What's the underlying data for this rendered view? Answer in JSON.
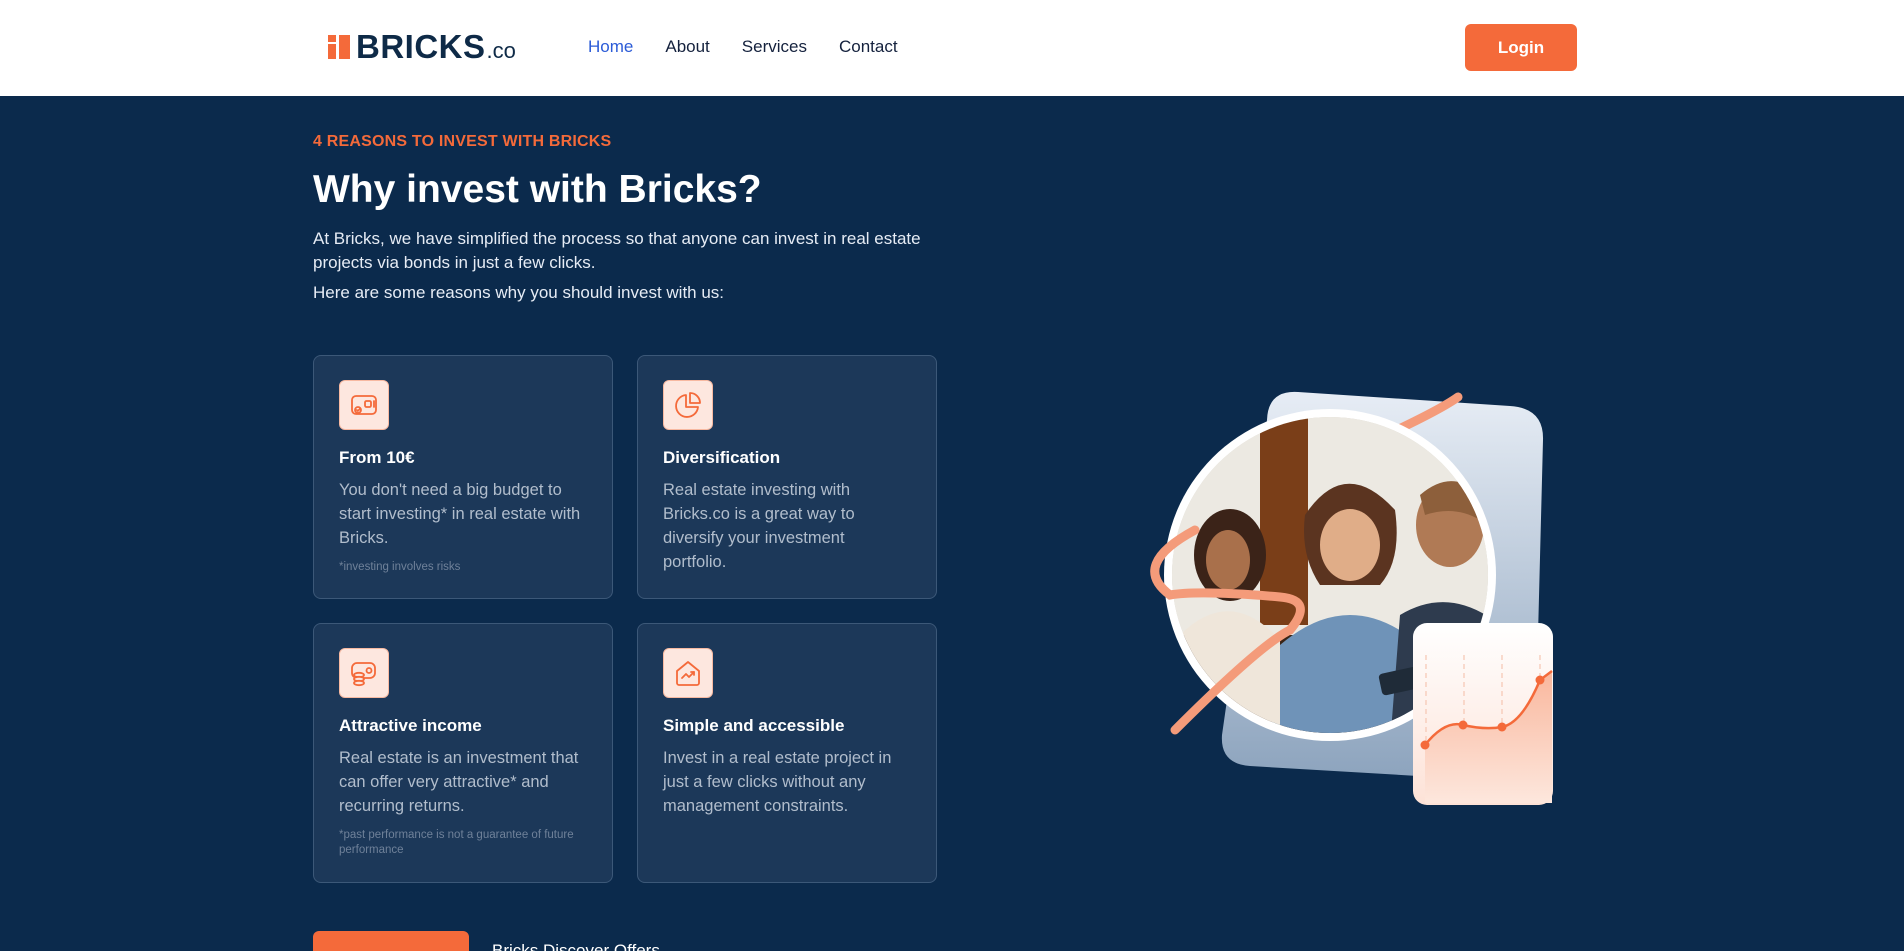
{
  "header": {
    "logo_name": "BRICKS",
    "logo_suffix": ".co",
    "nav": [
      {
        "label": "Home"
      },
      {
        "label": "About"
      },
      {
        "label": "Services"
      },
      {
        "label": "Contact"
      }
    ],
    "login_label": "Login"
  },
  "section": {
    "eyebrow": "4 REASONS TO INVEST WITH BRICKS",
    "title": "Why invest with Bricks?",
    "intro": "At Bricks, we have simplified the process so that anyone can invest in real estate projects via bonds in just a few clicks.",
    "intro2": "Here are some reasons why you should invest with us:"
  },
  "cards": [
    {
      "icon": "wallet-icon",
      "title": "From 10€",
      "text": "You don't need a big budget to start investing* in real estate with Bricks.",
      "note": "*investing involves risks"
    },
    {
      "icon": "pie-chart-icon",
      "title": "Diversification",
      "text": "Real estate investing with Bricks.co is a great way to diversify your investment portfolio.",
      "note": ""
    },
    {
      "icon": "coins-icon",
      "title": "Attractive income",
      "text": "Real estate is an investment that can offer very attractive* and recurring returns.",
      "note": "*past performance is not a guarantee of future performance"
    },
    {
      "icon": "house-growth-icon",
      "title": "Simple and accessible",
      "text": "Invest in a real estate project in just a few clicks without any management constraints.",
      "note": ""
    }
  ],
  "bottom": {
    "cta_label": "",
    "secondary_label": "Bricks Discover Offers"
  },
  "colors": {
    "accent": "#f46a3a",
    "background": "#0b2a4c",
    "card": "#1c3859",
    "nav_active": "#2b5bd7"
  }
}
